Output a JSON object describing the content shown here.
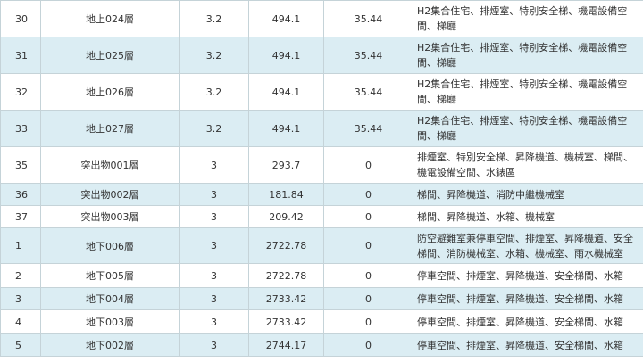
{
  "rows": [
    {
      "no": "30",
      "floor": "地上024層",
      "height": "3.2",
      "area": "494.1",
      "ratio": "35.44",
      "use": "H2集合住宅、排煙室、特別安全梯、機電設備空間、梯廳"
    },
    {
      "no": "31",
      "floor": "地上025層",
      "height": "3.2",
      "area": "494.1",
      "ratio": "35.44",
      "use": "H2集合住宅、排煙室、特別安全梯、機電設備空間、梯廳"
    },
    {
      "no": "32",
      "floor": "地上026層",
      "height": "3.2",
      "area": "494.1",
      "ratio": "35.44",
      "use": "H2集合住宅、排煙室、特別安全梯、機電設備空間、梯廳"
    },
    {
      "no": "33",
      "floor": "地上027層",
      "height": "3.2",
      "area": "494.1",
      "ratio": "35.44",
      "use": "H2集合住宅、排煙室、特別安全梯、機電設備空間、梯廳"
    },
    {
      "no": "35",
      "floor": "突出物001層",
      "height": "3",
      "area": "293.7",
      "ratio": "0",
      "use": "排煙室、特別安全梯、昇降機道、機械室、梯間、機電設備空間、水錶區"
    },
    {
      "no": "36",
      "floor": "突出物002層",
      "height": "3",
      "area": "181.84",
      "ratio": "0",
      "use": "梯間、昇降機道、消防中繼機械室"
    },
    {
      "no": "37",
      "floor": "突出物003層",
      "height": "3",
      "area": "209.42",
      "ratio": "0",
      "use": "梯間、昇降機道、水箱、機械室"
    },
    {
      "no": "1",
      "floor": "地下006層",
      "height": "3",
      "area": "2722.78",
      "ratio": "0",
      "use": "防空避難室兼停車空間、排煙室、昇降機道、安全梯間、消防機械室、水箱、機械室、雨水機械室"
    },
    {
      "no": "2",
      "floor": "地下005層",
      "height": "3",
      "area": "2722.78",
      "ratio": "0",
      "use": "停車空間、排煙室、昇降機道、安全梯間、水箱"
    },
    {
      "no": "3",
      "floor": "地下004層",
      "height": "3",
      "area": "2733.42",
      "ratio": "0",
      "use": "停車空間、排煙室、昇降機道、安全梯間、水箱"
    },
    {
      "no": "4",
      "floor": "地下003層",
      "height": "3",
      "area": "2733.42",
      "ratio": "0",
      "use": "停車空間、排煙室、昇降機道、安全梯間、水箱"
    },
    {
      "no": "5",
      "floor": "地下002層",
      "height": "3",
      "area": "2744.17",
      "ratio": "0",
      "use": "停車空間、排煙室、昇降機道、安全梯間、水箱"
    }
  ]
}
